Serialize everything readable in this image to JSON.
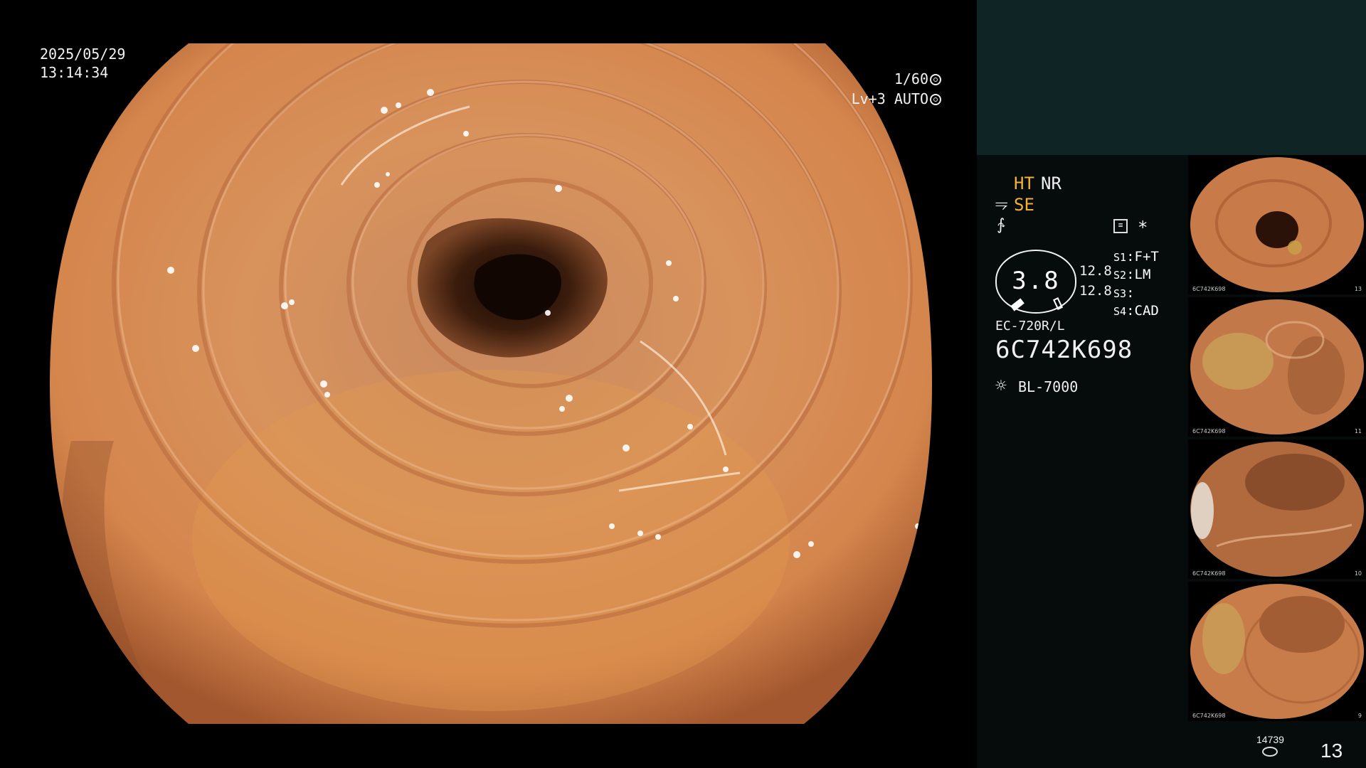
{
  "main_view": {
    "date": "2025/05/29",
    "time": "13:14:34",
    "shutter_speed": "1/60",
    "level": "Lv+3",
    "exposure_mode": "AUTO"
  },
  "side_panel": {
    "modes": {
      "ht": "HT",
      "nr": "NR",
      "se": "SE"
    },
    "gauge": {
      "value": "3.8",
      "right_top": "12.8",
      "right_bottom": "12.8"
    },
    "switches": [
      {
        "key": "S1",
        "value": "F+T"
      },
      {
        "key": "S2",
        "value": "LM"
      },
      {
        "key": "S3",
        "value": ""
      },
      {
        "key": "S4",
        "value": "CAD"
      }
    ],
    "scope_model": "EC-720R/L",
    "scope_serial": "6C742K698",
    "light_source": "BL-7000",
    "icons": [
      "tool-icon",
      "pen-icon",
      "document-icon",
      "asterisk-icon",
      "sun-icon",
      "storage-icon"
    ]
  },
  "thumbnails": [
    {
      "id": "6C742K698",
      "num": "13"
    },
    {
      "id": "6C742K698",
      "num": "11"
    },
    {
      "id": "6C742K698",
      "num": "10"
    },
    {
      "id": "6C742K698",
      "num": "9"
    }
  ],
  "footer": {
    "storage_count": "14739",
    "image_count": "13"
  },
  "colors": {
    "panel_teal": "#0e2425",
    "panel_dark": "#060c0c",
    "accent_orange": "#f3b233",
    "tissue": "#d58a55"
  }
}
